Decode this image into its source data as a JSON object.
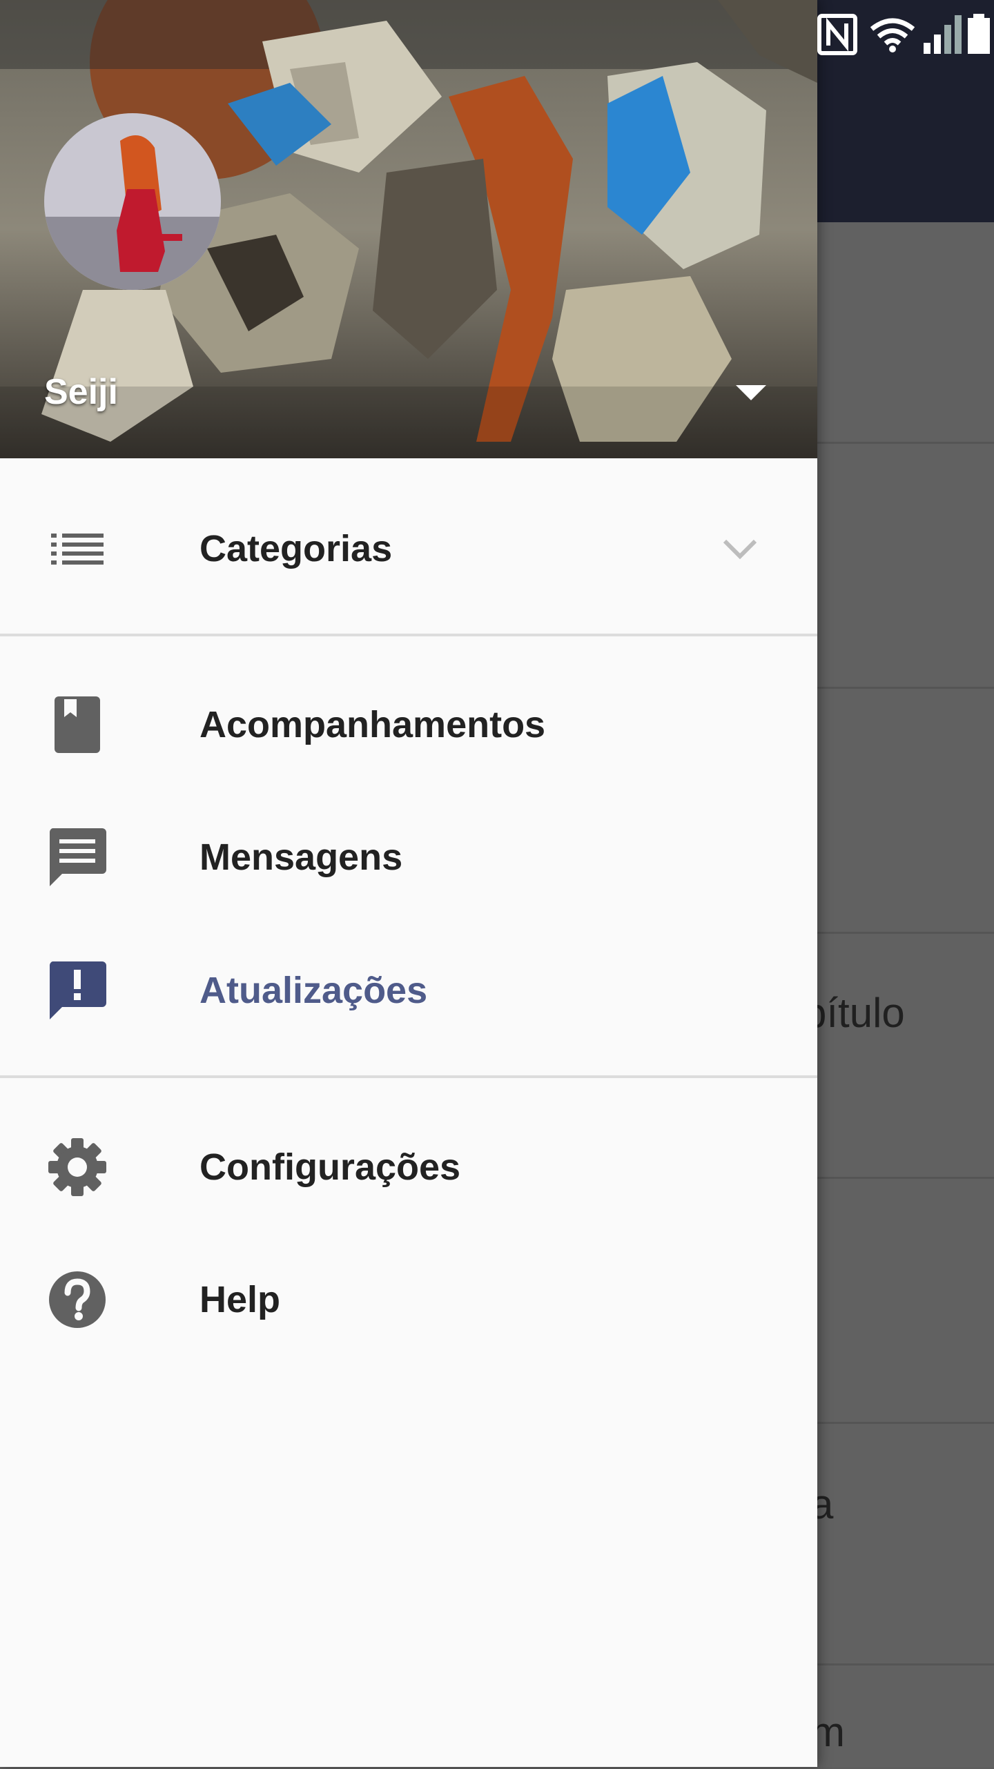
{
  "background_items": [
    "bítulo",
    "a",
    "m"
  ],
  "drawer": {
    "account": {
      "name": "Seiji"
    },
    "categories": {
      "label": "Categorias"
    },
    "items": [
      {
        "label": "Acompanhamentos",
        "icon": "bookmark-icon"
      },
      {
        "label": "Mensagens",
        "icon": "message-icon"
      },
      {
        "label": "Atualizações",
        "icon": "announcement-icon",
        "active": true
      }
    ],
    "bottom_items": [
      {
        "label": "Configurações",
        "icon": "gear-icon"
      },
      {
        "label": "Help",
        "icon": "help-icon"
      }
    ]
  },
  "colors": {
    "accent": "#4f5b8a",
    "appbar": "#1c1f2e",
    "scrim": "#616161",
    "drawer_bg": "#fafafa"
  }
}
